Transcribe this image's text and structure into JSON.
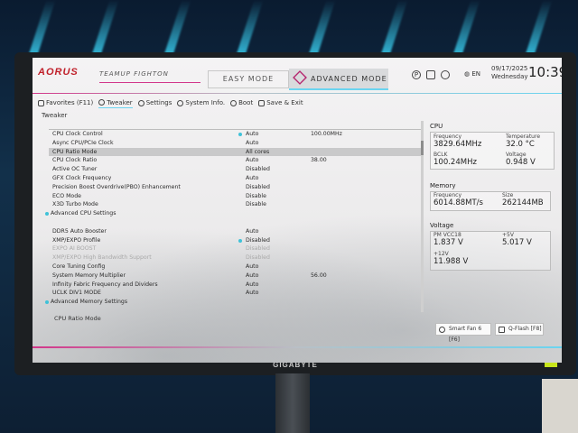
{
  "monitor_brand": "GIGABYTE",
  "header": {
    "logo": "AORUS",
    "team": "TEAMUP FIGHTON",
    "easy_mode": "EASY MODE",
    "advanced_mode": "ADVANCED MODE",
    "language": "EN",
    "date": "09/17/2025",
    "day": "Wednesday",
    "time": "10:39"
  },
  "nav": {
    "favorites": "Favorites (F11)",
    "tweaker": "Tweaker",
    "settings": "Settings",
    "system_info": "System Info.",
    "boot": "Boot",
    "save_exit": "Save & Exit"
  },
  "section_title": "Tweaker",
  "rows": [
    {
      "label": "CPU Clock Control",
      "value": "Auto",
      "value2": "100.00MHz"
    },
    {
      "label": "Async CPU/PCIe Clock",
      "value": "Auto",
      "value2": ""
    },
    {
      "label": "CPU Ratio Mode",
      "value": "All cores",
      "value2": ""
    },
    {
      "label": "CPU Clock Ratio",
      "value": "Auto",
      "value2": "38.00"
    },
    {
      "label": "Active OC Tuner",
      "value": "Disabled",
      "value2": ""
    },
    {
      "label": "GFX Clock Frequency",
      "value": "Auto",
      "value2": ""
    },
    {
      "label": "Precision Boost Overdrive(PBO) Enhancement",
      "value": "Disabled",
      "value2": ""
    },
    {
      "label": "ECO Mode",
      "value": "Disable",
      "value2": ""
    },
    {
      "label": "X3D Turbo Mode",
      "value": "Disable",
      "value2": ""
    },
    {
      "label": "Advanced CPU Settings",
      "value": "",
      "value2": ""
    },
    {
      "label": "DDR5 Auto Booster",
      "value": "Auto",
      "value2": ""
    },
    {
      "label": "XMP/EXPO Profile",
      "value": "Disabled",
      "value2": ""
    },
    {
      "label": "EXPO AI BOOST",
      "value": "Disabled",
      "value2": ""
    },
    {
      "label": "XMP/EXPO High Bandwidth Support",
      "value": "Disabled",
      "value2": ""
    },
    {
      "label": "Core Tuning Config",
      "value": "Auto",
      "value2": ""
    },
    {
      "label": "System Memory Multiplier",
      "value": "Auto",
      "value2": "56.00"
    },
    {
      "label": "Infinity Fabric Frequency and Dividers",
      "value": "Auto",
      "value2": ""
    },
    {
      "label": "UCLK DIV1 MODE",
      "value": "Auto",
      "value2": ""
    },
    {
      "label": "Advanced Memory Settings",
      "value": "",
      "value2": ""
    }
  ],
  "help_text": "CPU Ratio Mode",
  "cpu": {
    "title": "CPU",
    "freq_label": "Frequency",
    "freq": "3829.64MHz",
    "temp_label": "Temperature",
    "temp": "32.0 °C",
    "bclk_label": "BCLK",
    "bclk": "100.24MHz",
    "volt_label": "Voltage",
    "volt": "0.948 V"
  },
  "memory": {
    "title": "Memory",
    "freq_label": "Frequency",
    "freq": "6014.88MT/s",
    "size_label": "Size",
    "size": "262144MB"
  },
  "voltage": {
    "title": "Voltage",
    "vcc_label": "PM VCC18",
    "vcc": "1.837 V",
    "v5_label": "+5V",
    "v5": "5.017 V",
    "v12_label": "+12V",
    "v12": "11.988 V"
  },
  "buttons": {
    "smart_fan": "Smart Fan 6 [F6]",
    "qflash": "Q-Flash [F8]"
  }
}
